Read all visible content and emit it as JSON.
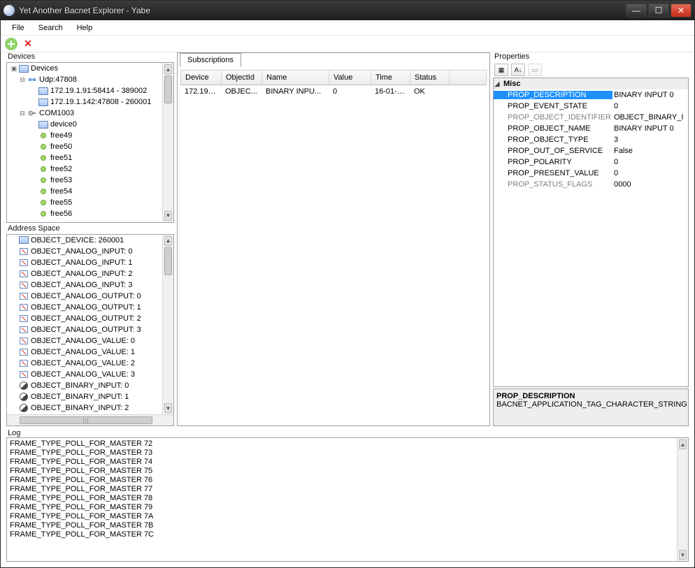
{
  "window": {
    "title": "Yet Another Bacnet Explorer - Yabe"
  },
  "menu": {
    "file": "File",
    "search": "Search",
    "help": "Help"
  },
  "devicesPanel": {
    "label": "Devices",
    "root": "Devices",
    "udp": "Udp:47808",
    "dev1": "172.19.1.91:58414 - 389002",
    "dev2": "172.19.1.142:47808 - 260001",
    "com": "COM1003",
    "comdev": "device0",
    "free": [
      "free49",
      "free50",
      "free51",
      "free52",
      "free53",
      "free54",
      "free55",
      "free56"
    ]
  },
  "addressPanel": {
    "label": "Address Space",
    "root": "OBJECT_DEVICE: 260001",
    "items": [
      "OBJECT_ANALOG_INPUT: 0",
      "OBJECT_ANALOG_INPUT: 1",
      "OBJECT_ANALOG_INPUT: 2",
      "OBJECT_ANALOG_INPUT: 3",
      "OBJECT_ANALOG_OUTPUT: 0",
      "OBJECT_ANALOG_OUTPUT: 1",
      "OBJECT_ANALOG_OUTPUT: 2",
      "OBJECT_ANALOG_OUTPUT: 3",
      "OBJECT_ANALOG_VALUE: 0",
      "OBJECT_ANALOG_VALUE: 1",
      "OBJECT_ANALOG_VALUE: 2",
      "OBJECT_ANALOG_VALUE: 3",
      "OBJECT_BINARY_INPUT: 0",
      "OBJECT_BINARY_INPUT: 1",
      "OBJECT_BINARY_INPUT: 2"
    ]
  },
  "subs": {
    "tab": "Subscriptions",
    "hdr": {
      "device": "Device",
      "objectid": "ObjectId",
      "name": "Name",
      "value": "Value",
      "time": "Time",
      "status": "Status"
    },
    "row": {
      "device": "172.19.1...",
      "objectid": "OBJEC...",
      "name": "BINARY INPU...",
      "value": "0",
      "time": "16-01-2...",
      "status": "OK"
    }
  },
  "props": {
    "label": "Properties",
    "cat": "Misc",
    "rows": [
      {
        "k": "PROP_DESCRIPTION",
        "v": "BINARY INPUT 0",
        "sel": true
      },
      {
        "k": "PROP_EVENT_STATE",
        "v": "0"
      },
      {
        "k": "PROP_OBJECT_IDENTIFIER",
        "v": "OBJECT_BINARY_I",
        "dim": true
      },
      {
        "k": "PROP_OBJECT_NAME",
        "v": "BINARY INPUT 0"
      },
      {
        "k": "PROP_OBJECT_TYPE",
        "v": "3"
      },
      {
        "k": "PROP_OUT_OF_SERVICE",
        "v": "False"
      },
      {
        "k": "PROP_POLARITY",
        "v": "0"
      },
      {
        "k": "PROP_PRESENT_VALUE",
        "v": "0"
      },
      {
        "k": "PROP_STATUS_FLAGS",
        "v": "0000",
        "dim": true
      }
    ],
    "desc": {
      "h": "PROP_DESCRIPTION",
      "b": "BACNET_APPLICATION_TAG_CHARACTER_STRING"
    }
  },
  "log": {
    "label": "Log",
    "lines": [
      "FRAME_TYPE_POLL_FOR_MASTER 72",
      "FRAME_TYPE_POLL_FOR_MASTER 73",
      "FRAME_TYPE_POLL_FOR_MASTER 74",
      "FRAME_TYPE_POLL_FOR_MASTER 75",
      "FRAME_TYPE_POLL_FOR_MASTER 76",
      "FRAME_TYPE_POLL_FOR_MASTER 77",
      "FRAME_TYPE_POLL_FOR_MASTER 78",
      "FRAME_TYPE_POLL_FOR_MASTER 79",
      "FRAME_TYPE_POLL_FOR_MASTER 7A",
      "FRAME_TYPE_POLL_FOR_MASTER 7B",
      "FRAME_TYPE_POLL_FOR_MASTER 7C"
    ]
  }
}
